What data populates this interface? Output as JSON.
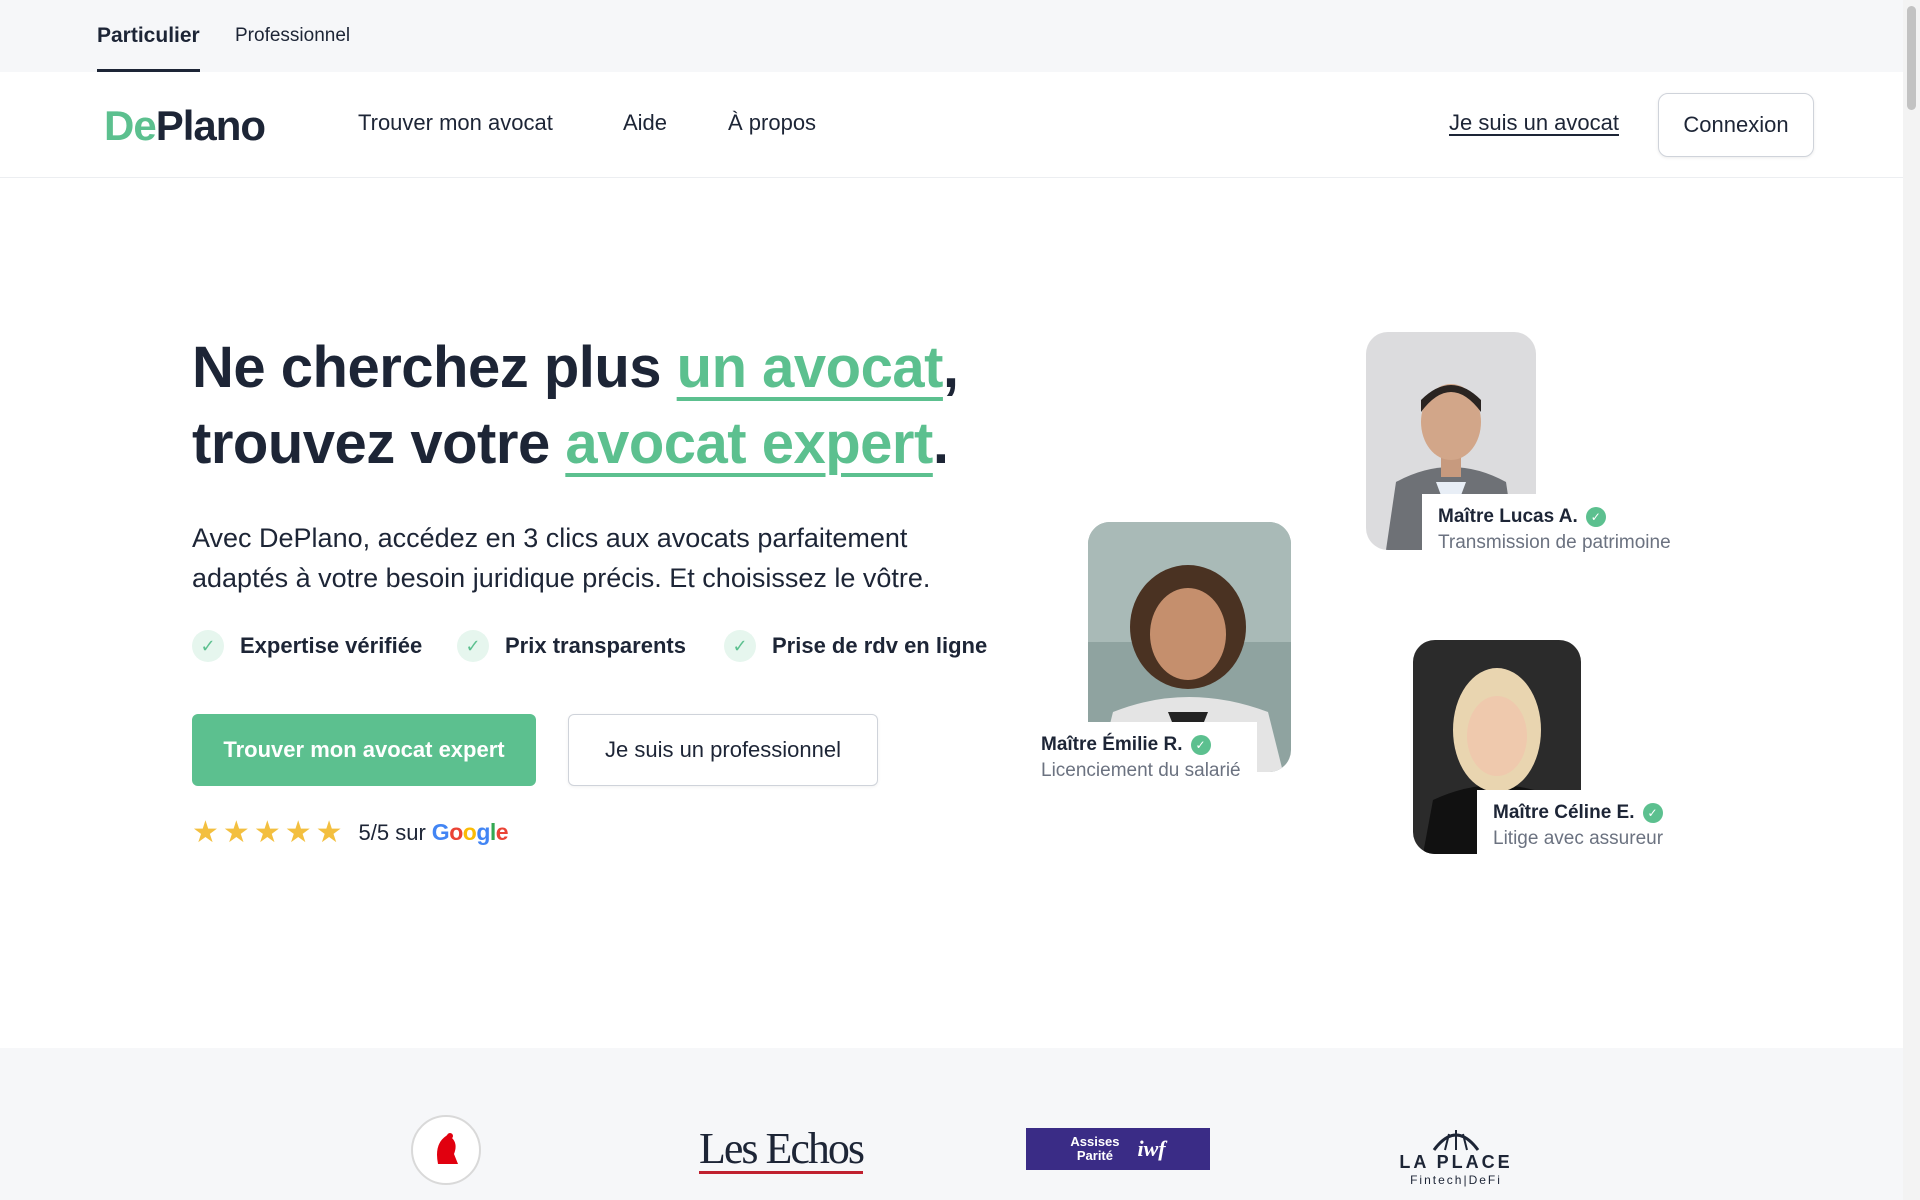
{
  "topbar": {
    "tabs": [
      {
        "label": "Particulier",
        "active": true
      },
      {
        "label": "Professionnel",
        "active": false
      }
    ]
  },
  "nav": {
    "logo_de": "De",
    "logo_plano": "Plano",
    "links": [
      "Trouver mon avocat",
      "Aide",
      "À propos"
    ],
    "lawyer_link": "Je suis un avocat",
    "login_button": "Connexion"
  },
  "hero": {
    "title_part1": "Ne cherchez plus ",
    "title_accent1": "un avocat",
    "title_part2": ",",
    "title_part3": "trouvez votre ",
    "title_accent2": "avocat expert",
    "title_part4": ".",
    "subtitle": "Avec DePlano, accédez en 3 clics aux avocats parfaitement adaptés à votre besoin juridique précis. Et choisissez le vôtre.",
    "features": [
      "Expertise vérifiée",
      "Prix transparents",
      "Prise de rdv en ligne"
    ],
    "cta_primary": "Trouver mon avocat expert",
    "cta_secondary": "Je suis un professionnel",
    "rating_text": "5/5 sur",
    "rating_stars": 5,
    "google": [
      "G",
      "o",
      "o",
      "g",
      "l",
      "e"
    ]
  },
  "lawyers": [
    {
      "name": "Maître Lucas A.",
      "specialty": "Transmission de patrimoine"
    },
    {
      "name": "Maître Émilie R.",
      "specialty": "Licenciement du salarié"
    },
    {
      "name": "Maître Céline E.",
      "specialty": "Litige avec assureur"
    }
  ],
  "press": {
    "lesechos": "Les Echos",
    "assises_line1": "Assises",
    "assises_line2": "Parité",
    "laplace_title": "LA PLACE",
    "laplace_sub": "Fintech|DeFi"
  },
  "colors": {
    "accent": "#5cc08f",
    "text": "#1d2536",
    "star": "#f3bf3f"
  }
}
